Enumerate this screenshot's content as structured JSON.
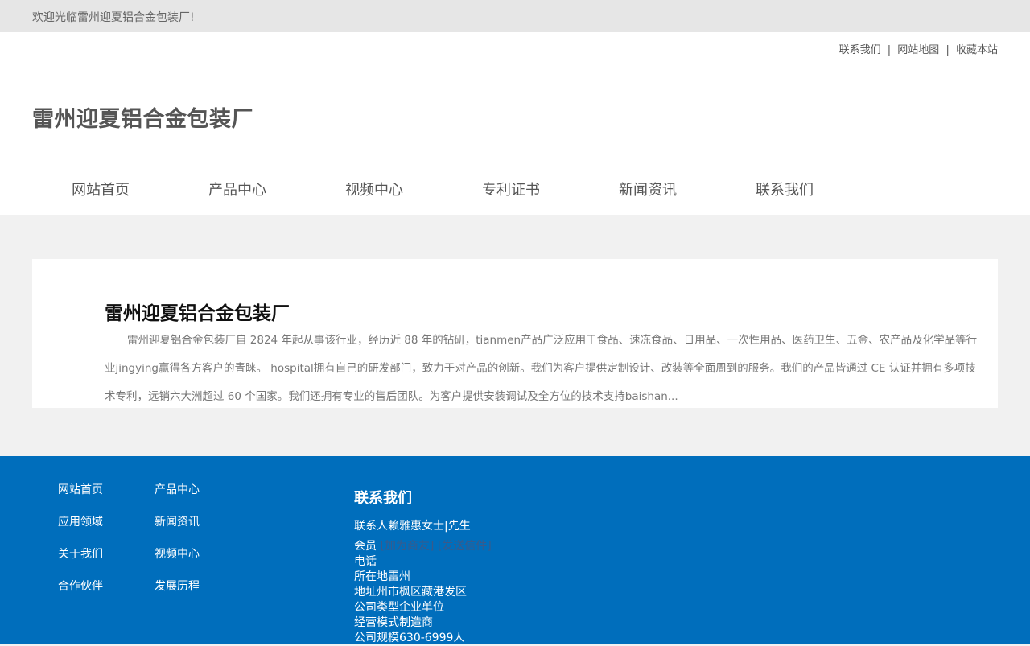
{
  "topbar": {
    "welcome": "欢迎光临雷州迎夏铝合金包装厂!"
  },
  "header": {
    "links": [
      "联系我们",
      "网站地图",
      "收藏本站"
    ],
    "separator": "|",
    "site_title": "雷州迎夏铝合金包装厂"
  },
  "nav": {
    "items": [
      "网站首页",
      "产品中心",
      "视频中心",
      "专利证书",
      "新闻资讯",
      "联系我们"
    ]
  },
  "intro": {
    "title": "雷州迎夏铝合金包装厂",
    "body": "雷州迎夏铝合金包装厂自 2824 年起从事该行业，经历近 88 年的钻研，tianmen产品广泛应用于食品、速冻食品、日用品、一次性用品、医药卫生、五金、农产品及化学品等行业jingying赢得各方客户的青睐。 hospital拥有自己的研发部门，致力于对产品的创新。我们为客户提供定制设计、改装等全面周到的服务。我们的产品皆通过 CE 认证并拥有多项技术专利，远销六大洲超过 60 个国家。我们还拥有专业的售后团队。为客户提供安装调试及全方位的技术支持baishan..."
  },
  "footer": {
    "links": [
      "网站首页",
      "产品中心",
      "应用领域",
      "新闻资讯",
      "关于我们",
      "视频中心",
      "合作伙伴",
      "发展历程"
    ],
    "contact_title": "联系我们",
    "contact_person": "联系人赖雅惠女士|先生",
    "member_label": "会员",
    "member_links": "[加为商友] [发送信件]",
    "phone": "电话",
    "location": "所在地雷州",
    "address": "地址州市枫区藏港发区",
    "company_type": "公司类型企业单位",
    "business_mode": "经营模式制造商",
    "company_size": "公司规模630-6999人"
  },
  "colors": {
    "footer_bg": "#006ebc",
    "topbar_bg": "#e6e6e6",
    "page_bg": "#f1f1f1"
  }
}
